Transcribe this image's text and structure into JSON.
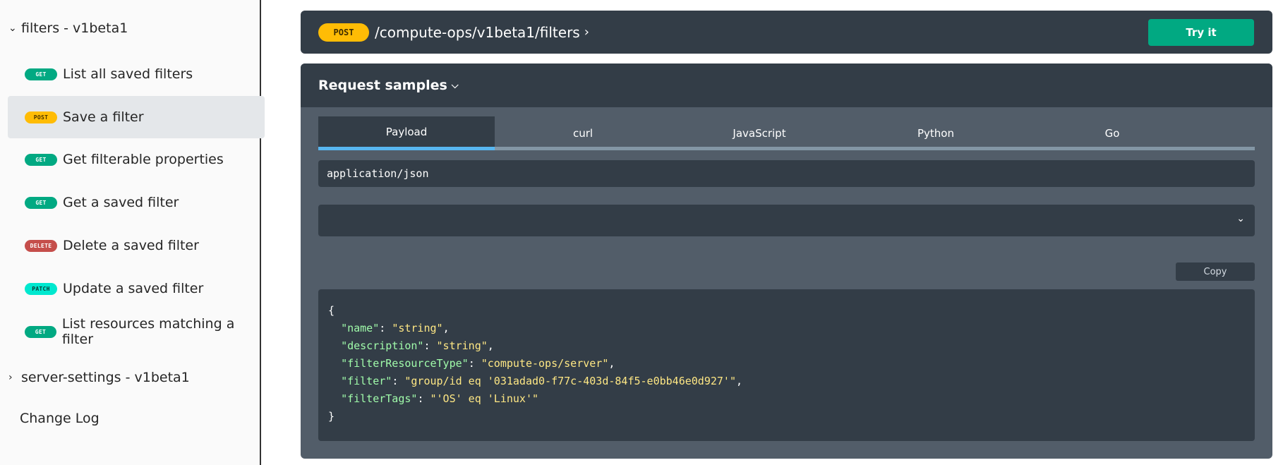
{
  "sidebar": {
    "group_filters": {
      "label": "filters - v1beta1",
      "chevron": "chevron-down-icon"
    },
    "items": [
      {
        "method": "GET",
        "label": "List all saved filters"
      },
      {
        "method": "POST",
        "label": "Save a filter"
      },
      {
        "method": "GET",
        "label": "Get filterable properties"
      },
      {
        "method": "GET",
        "label": "Get a saved filter"
      },
      {
        "method": "DELETE",
        "label": "Delete a saved filter"
      },
      {
        "method": "PATCH",
        "label": "Update a saved filter"
      },
      {
        "method": "GET",
        "label": "List resources matching a filter"
      }
    ],
    "group_server_settings": {
      "label": "server-settings - v1beta1",
      "chevron": "chevron-right-icon"
    },
    "change_log": "Change Log"
  },
  "endpoint": {
    "method": "POST",
    "path": "/compute-ops/v1beta1/filters",
    "try_label": "Try it"
  },
  "samples": {
    "title": "Request samples",
    "tabs": [
      "Payload",
      "curl",
      "JavaScript",
      "Python",
      "Go"
    ],
    "active_tab": "Payload",
    "content_type": "application/json",
    "copy_label": "Copy",
    "code": {
      "open": "{",
      "close": "}",
      "fields": [
        {
          "key": "\"name\"",
          "value": "\"string\"",
          "comma": ","
        },
        {
          "key": "\"description\"",
          "value": "\"string\"",
          "comma": ","
        },
        {
          "key": "\"filterResourceType\"",
          "value": "\"compute-ops/server\"",
          "comma": ","
        },
        {
          "key": "\"filter\"",
          "value": "\"group/id eq '031adad0-f77c-403d-84f5-e0bb46e0d927'\"",
          "comma": ","
        },
        {
          "key": "\"filterTags\"",
          "value": "\"'OS' eq 'Linux'\"",
          "comma": ""
        }
      ]
    }
  },
  "colors": {
    "get": "#01a982",
    "post": "#ffbc05",
    "delete": "#c54e4b",
    "patch": "#00e8cf",
    "panel_dark": "#333d47",
    "panel_mid": "#525d69",
    "active_tab_underline": "#58b6f0"
  }
}
